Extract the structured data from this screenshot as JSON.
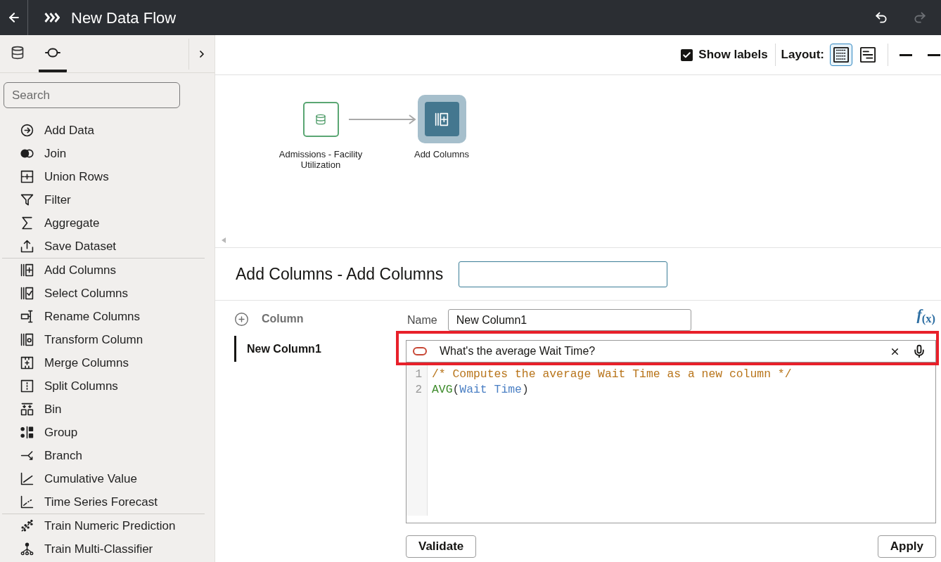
{
  "header": {
    "title": "New Data Flow",
    "history": [
      {
        "kind": "undo",
        "disabled": false
      },
      {
        "kind": "redo",
        "disabled": true
      }
    ]
  },
  "sidebar": {
    "tabs": [
      {
        "kind": "data",
        "selected": false
      },
      {
        "kind": "steps",
        "selected": true
      }
    ],
    "search": {
      "placeholder": "Search"
    },
    "groups": [
      {
        "items": [
          {
            "kind": "add-data",
            "label": "Add Data"
          },
          {
            "kind": "join",
            "label": "Join"
          },
          {
            "kind": "union-rows",
            "label": "Union Rows"
          },
          {
            "kind": "filter",
            "label": "Filter"
          },
          {
            "kind": "aggregate",
            "label": "Aggregate"
          },
          {
            "kind": "save-dataset",
            "label": "Save Dataset"
          }
        ]
      },
      {
        "items": [
          {
            "kind": "add-columns",
            "label": "Add Columns"
          },
          {
            "kind": "select-columns",
            "label": "Select Columns"
          },
          {
            "kind": "rename-columns",
            "label": "Rename Columns"
          },
          {
            "kind": "transform-column",
            "label": "Transform Column"
          },
          {
            "kind": "merge-columns",
            "label": "Merge Columns"
          },
          {
            "kind": "split-columns",
            "label": "Split Columns"
          },
          {
            "kind": "bin",
            "label": "Bin"
          },
          {
            "kind": "group",
            "label": "Group"
          },
          {
            "kind": "branch",
            "label": "Branch"
          },
          {
            "kind": "cumulative-value",
            "label": "Cumulative Value"
          },
          {
            "kind": "time-series-forecast",
            "label": "Time Series Forecast"
          }
        ]
      },
      {
        "items": [
          {
            "kind": "train-numeric-prediction",
            "label": "Train Numeric Prediction"
          },
          {
            "kind": "train-multi-classifier",
            "label": "Train Multi-Classifier"
          }
        ]
      }
    ]
  },
  "toolbar": {
    "show_labels": {
      "label": "Show labels",
      "checked": true
    },
    "layout": {
      "label": "Layout:",
      "options": [
        {
          "kind": "grid",
          "selected": true
        },
        {
          "kind": "list",
          "selected": false
        }
      ]
    }
  },
  "canvas": {
    "nodes": [
      {
        "kind": "dataset",
        "label": "Admissions - Facility Utilization",
        "selected": false
      },
      {
        "kind": "add-columns",
        "label": "Add Columns",
        "selected": true
      }
    ]
  },
  "editor": {
    "title": "Add Columns - Add Columns",
    "columns": {
      "add_label": "Column",
      "items": [
        {
          "label": "New Column1",
          "selected": true
        }
      ]
    },
    "name_field": {
      "label": "Name",
      "value": "New Column1"
    },
    "function_button": "*f*$_{(x)}$",
    "ai_prompt": {
      "value": "What's the average Wait Time?",
      "highlighted": true
    },
    "code": {
      "lines": [
        {
          "number": "1",
          "tokens": [
            {
              "kind": "comment",
              "text": "/* Computes the average Wait Time as a new column */"
            }
          ]
        },
        {
          "number": "2",
          "tokens": [
            {
              "kind": "function",
              "text": "AVG"
            },
            {
              "kind": "punct",
              "text": "("
            },
            {
              "kind": "column",
              "text": "Wait Time"
            },
            {
              "kind": "punct",
              "text": ")"
            }
          ]
        }
      ]
    },
    "buttons": [
      "Validate",
      "Apply"
    ]
  }
}
